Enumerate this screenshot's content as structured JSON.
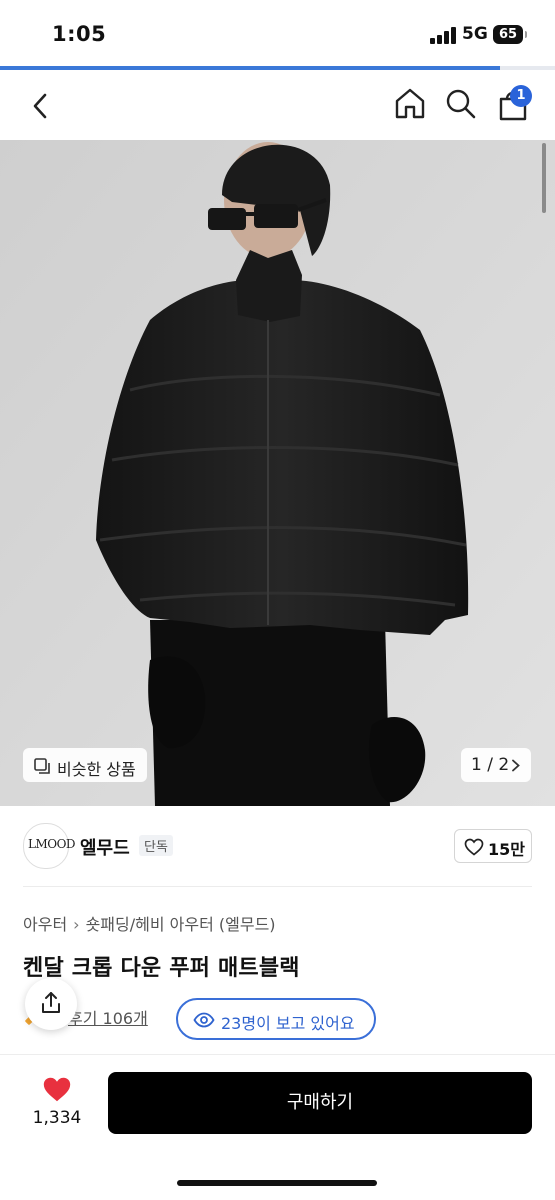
{
  "status_bar": {
    "time": "1:05",
    "network": "5G",
    "battery": "65"
  },
  "load_progress": 0.9,
  "nav": {
    "back_icon": "chevron-left-icon",
    "home_icon": "home-icon",
    "search_icon": "search-icon",
    "cart_icon": "shopping-bag-icon",
    "cart_badge": "1"
  },
  "gallery": {
    "similar_label": "비슷한 상품",
    "page_indicator": "1 / 2",
    "image_description_icon": "product-photo"
  },
  "brand": {
    "logo_text": "LMOOD",
    "name": "엘무드",
    "exclusive_badge": "단독",
    "like_count": "15만"
  },
  "product": {
    "breadcrumb": [
      "아우터",
      "숏패딩/헤비 아우터 (엘무드)"
    ],
    "title": "켄달 크롭 다운 푸퍼 매트블랙",
    "review_text": "후기 106개",
    "viewers_text": "23명이 보고 있어요"
  },
  "bottom_bar": {
    "wish_count": "1,334",
    "buy_label": "구매하기"
  },
  "colors": {
    "accent_blue": "#2f63cf",
    "like_red": "#e8313f",
    "buy_button": "#000000"
  }
}
